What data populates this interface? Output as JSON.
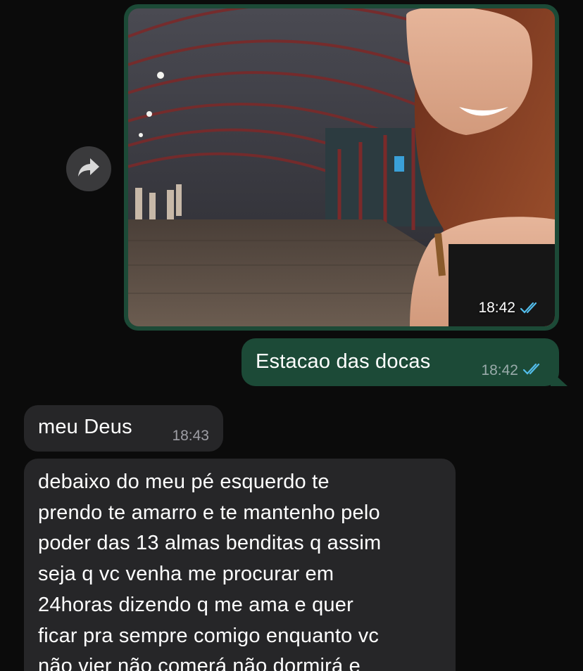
{
  "messages": {
    "photo": {
      "time": "18:42",
      "status_icon": "double-check-read-icon",
      "alt": "photo"
    },
    "outgoing_text": {
      "text": "Estacao das docas",
      "time": "18:42",
      "status_icon": "double-check-read-icon"
    },
    "incoming_short": {
      "text": "meu Deus",
      "time": "18:43"
    },
    "incoming_long": {
      "lines": [
        "debaixo do meu pé esquerdo te",
        "prendo te amarro e te mantenho pelo",
        "poder das 13 almas benditas q assim",
        "seja q vc venha me procurar em",
        "24horas dizendo q me ama e quer",
        "ficar pra sempre comigo enquanto vc",
        "não vier não comerá não dormirá e"
      ]
    }
  },
  "actions": {
    "forward_icon": "forward-share-icon"
  },
  "colors": {
    "background": "#0b0b0b",
    "outgoing_bubble": "#1c4a37",
    "incoming_bubble": "#262628",
    "read_check": "#53bdeb"
  }
}
